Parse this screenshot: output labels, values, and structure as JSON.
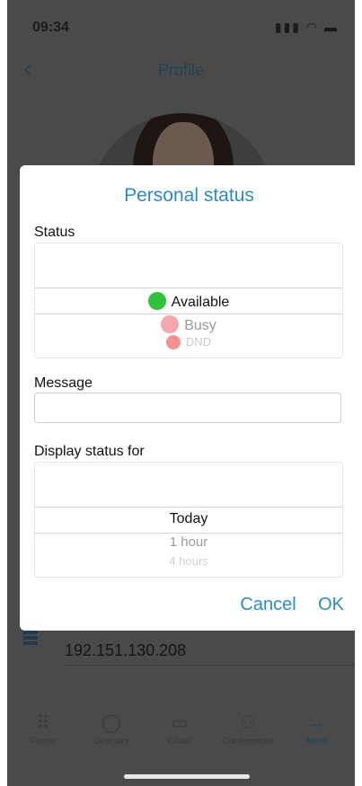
{
  "status_bar": {
    "time": "09:34",
    "icons": "signal wifi battery"
  },
  "nav": {
    "back_icon": "chevron-left",
    "title": "Profile"
  },
  "background": {
    "ip_address": "192.151.130.208"
  },
  "tabs": [
    {
      "label": "Phone",
      "icon": "dialpad"
    },
    {
      "label": "Directory",
      "icon": "person"
    },
    {
      "label": "Chats",
      "icon": "chat"
    },
    {
      "label": "Conferences",
      "icon": "group"
    },
    {
      "label": "More",
      "icon": "arrow-right"
    }
  ],
  "dialog": {
    "title": "Personal status",
    "status_label": "Status",
    "status_options": [
      {
        "label": "Available",
        "color": "#31c23c",
        "selected": true
      },
      {
        "label": "Busy",
        "color": "#f2a8ad",
        "selected": false
      },
      {
        "label": "DND",
        "color": "#f16363",
        "selected": false
      }
    ],
    "message_label": "Message",
    "message_value": "",
    "display_label": "Display status for",
    "display_options": [
      {
        "label": "Today",
        "selected": true
      },
      {
        "label": "1 hour",
        "selected": false
      },
      {
        "label": "4 hours",
        "selected": false
      }
    ],
    "cancel_label": "Cancel",
    "ok_label": "OK"
  },
  "colors": {
    "accent": "#2c8ac9",
    "overlay_bg": "#4a4a4a"
  }
}
